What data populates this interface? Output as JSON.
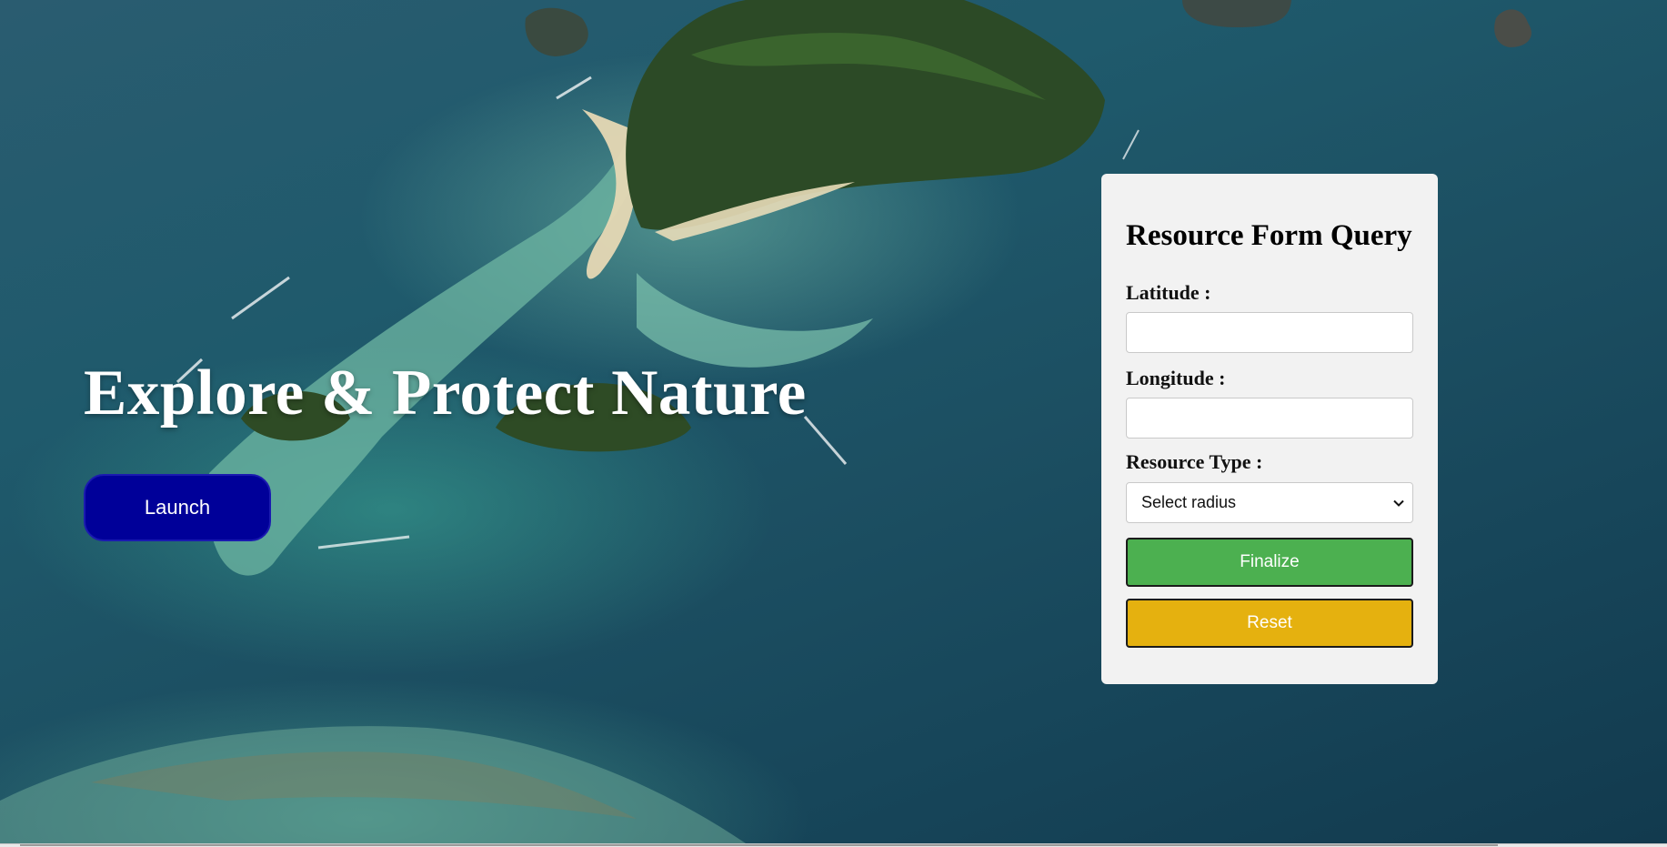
{
  "hero": {
    "title": "Explore & Protect Nature",
    "launch_label": "Launch"
  },
  "form": {
    "title": "Resource Form Query",
    "latitude_label": "Latitude :",
    "latitude_value": "",
    "longitude_label": "Longitude :",
    "longitude_value": "",
    "resource_type_label": "Resource Type :",
    "resource_type_selected": "Select radius",
    "finalize_label": "Finalize",
    "reset_label": "Reset"
  },
  "colors": {
    "launch_bg": "#000099",
    "finalize_bg": "#4cb050",
    "reset_bg": "#e5b10f",
    "panel_bg": "#f2f2f2"
  },
  "icons": {
    "select_arrow": "chevron-down-icon"
  }
}
